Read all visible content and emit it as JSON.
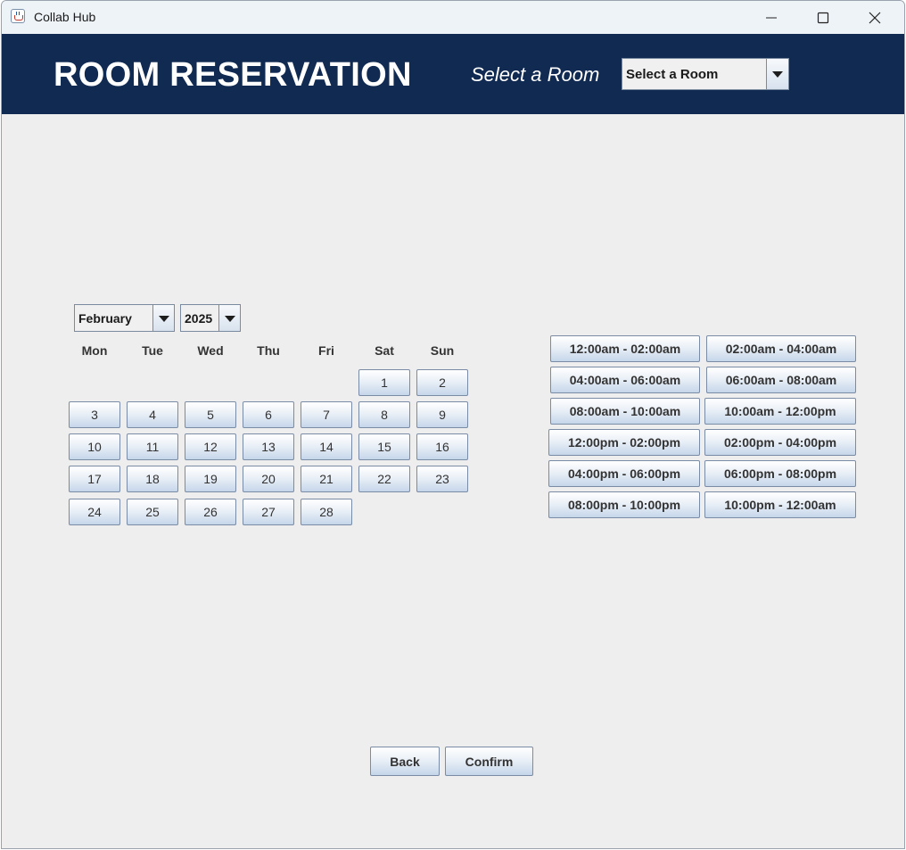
{
  "window": {
    "title": "Collab Hub",
    "controls": [
      "minimize",
      "maximize",
      "close"
    ]
  },
  "header": {
    "title": "ROOM RESERVATION",
    "room_label": "Select a Room",
    "room_select": {
      "value": "Select a Room"
    }
  },
  "calendar": {
    "month": "February",
    "year": "2025",
    "weekdays": [
      "Mon",
      "Tue",
      "Wed",
      "Thu",
      "Fri",
      "Sat",
      "Sun"
    ],
    "days": [
      "1",
      "2",
      "3",
      "4",
      "5",
      "6",
      "7",
      "8",
      "9",
      "10",
      "11",
      "12",
      "13",
      "14",
      "15",
      "16",
      "17",
      "18",
      "19",
      "20",
      "21",
      "22",
      "23",
      "24",
      "25",
      "26",
      "27",
      "28"
    ]
  },
  "timeslots": [
    "12:00am - 02:00am",
    "02:00am - 04:00am",
    "04:00am - 06:00am",
    "06:00am - 08:00am",
    "08:00am - 10:00am",
    "10:00am - 12:00pm",
    "12:00pm - 02:00pm",
    "02:00pm - 04:00pm",
    "04:00pm - 06:00pm",
    "06:00pm - 08:00pm",
    "08:00pm - 10:00pm",
    "10:00pm - 12:00am"
  ],
  "actions": {
    "back_label": "Back",
    "confirm_label": "Confirm"
  },
  "colors": {
    "header_bg": "#112a52",
    "content_bg": "#eeeeee",
    "button_border": "#7a8ba6"
  }
}
